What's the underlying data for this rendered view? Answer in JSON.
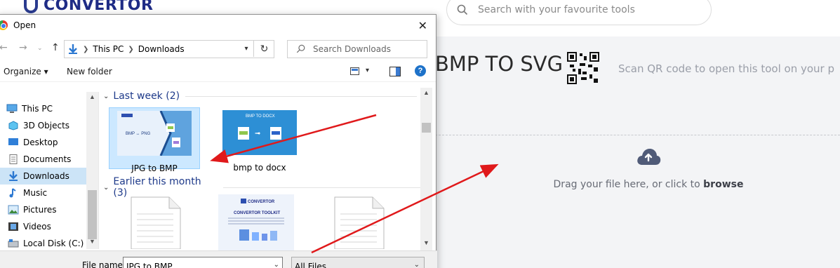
{
  "site": {
    "logo_text": "CONVERTOR",
    "search_placeholder": "Search with your favourite tools",
    "tool_title": "BMP TO SVG",
    "qr_text": "Scan QR code to open this tool on your p",
    "drop_text": "Drag your file here, or click to",
    "drop_link": "browse"
  },
  "dialog": {
    "title": "Open",
    "close_label": "✕",
    "breadcrumb": [
      "This PC",
      "Downloads"
    ],
    "search_placeholder": "Search Downloads",
    "commands": {
      "organize": "Organize ▾",
      "new_folder": "New folder"
    },
    "help_label": "?",
    "nav_items": [
      {
        "label": "This PC",
        "icon": "pc-icon"
      },
      {
        "label": "3D Objects",
        "icon": "cube-icon"
      },
      {
        "label": "Desktop",
        "icon": "desktop-icon"
      },
      {
        "label": "Documents",
        "icon": "documents-icon"
      },
      {
        "label": "Downloads",
        "icon": "download-icon",
        "selected": true
      },
      {
        "label": "Music",
        "icon": "music-icon"
      },
      {
        "label": "Pictures",
        "icon": "pictures-icon"
      },
      {
        "label": "Videos",
        "icon": "videos-icon"
      },
      {
        "label": "Local Disk (C:)",
        "icon": "disk-icon"
      }
    ],
    "groups": [
      {
        "label": "Last week (2)"
      },
      {
        "label": "Earlier this month (3)"
      }
    ],
    "files": [
      {
        "name": "JPG to BMP",
        "selected": true,
        "thumb_text": "BMP ↔ PNG"
      },
      {
        "name": "bmp to docx",
        "selected": false,
        "thumb_text": "BMP TO DOCX"
      }
    ],
    "recent_thumb": {
      "brand": "CONVERTOR",
      "title": "CONVERTOR TOOLKIT"
    },
    "file_name_label": "File name:",
    "file_name_value": "JPG to BMP",
    "file_type_value": "All Files"
  },
  "colors": {
    "brand": "#1f2c86",
    "arrow": "#e0191b",
    "selection": "#cce8ff"
  }
}
